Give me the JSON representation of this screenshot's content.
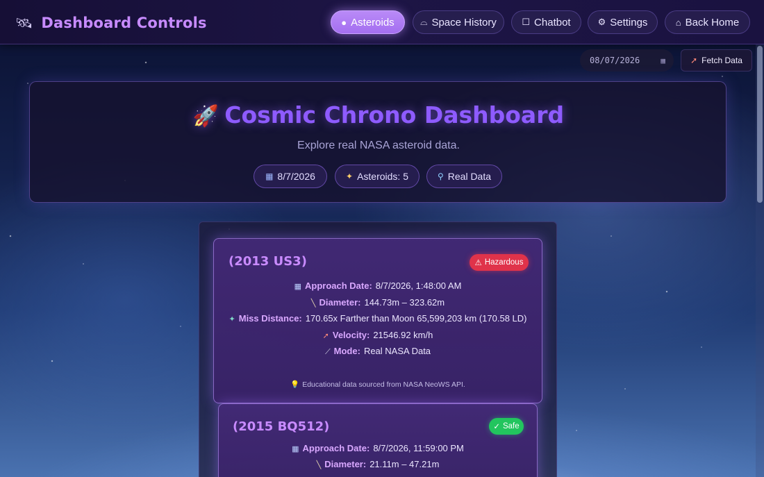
{
  "navbar": {
    "brand_icon": "satellite-icon",
    "brand_title": "Dashboard Controls",
    "buttons": [
      {
        "label": "Asteroids",
        "icon": "asteroid-icon",
        "active": true
      },
      {
        "label": "Space History",
        "icon": "ufo-icon",
        "active": false
      },
      {
        "label": "Chatbot",
        "icon": "robot-icon",
        "active": false
      },
      {
        "label": "Settings",
        "icon": "gear-icon",
        "active": false
      },
      {
        "label": "Back Home",
        "icon": "house-icon",
        "active": false
      }
    ]
  },
  "controls": {
    "date_value": "08/07/2026",
    "fetch_label": "Fetch Data"
  },
  "hero": {
    "title": "Cosmic Chrono Dashboard",
    "subtitle": "Explore real NASA asteroid data.",
    "pills": [
      {
        "label": "8/7/2026",
        "icon": "calendar-icon"
      },
      {
        "label": "Asteroids: 5",
        "icon": "comet-icon"
      },
      {
        "label": "Real Data",
        "icon": "magnifier-icon"
      }
    ]
  },
  "asteroids": [
    {
      "name": "(2013 US3)",
      "status": "Hazardous",
      "approach_label": "Approach Date:",
      "approach": "8/7/2026, 1:48:00 AM",
      "diameter_label": "Diameter:",
      "diameter": "144.73m – 323.62m",
      "miss_label": "Miss Distance:",
      "miss": "170.65x Farther than Moon 65,599,203 km (170.58 LD)",
      "velocity_label": "Velocity:",
      "velocity": "21546.92 km/h",
      "mode_label": "Mode:",
      "mode": "Real NASA Data",
      "note": "Educational data sourced from NASA NeoWS API."
    },
    {
      "name": "(2015 BQ512)",
      "status": "Safe",
      "approach_label": "Approach Date:",
      "approach": "8/7/2026, 11:59:00 PM",
      "diameter_label": "Diameter:",
      "diameter": "21.11m – 47.21m"
    }
  ],
  "colors": {
    "accent": "#a46ff0",
    "title": "#8e5bff",
    "hazard": "#e0334a",
    "safe": "#22c55e"
  }
}
